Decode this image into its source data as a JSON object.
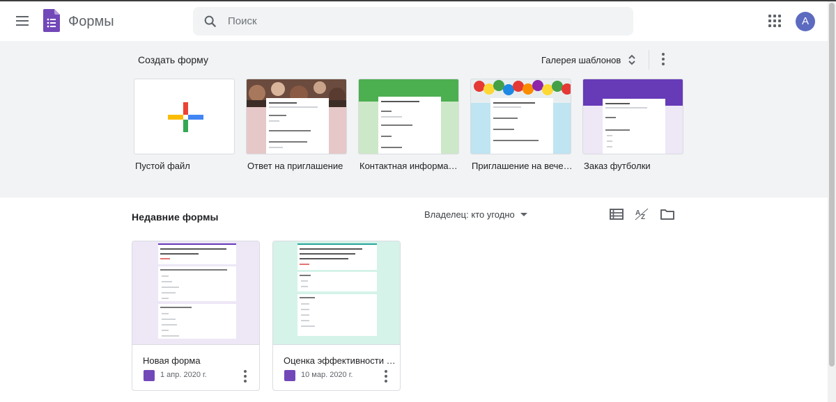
{
  "header": {
    "app_title": "Формы",
    "search_placeholder": "Поиск",
    "avatar_letter": "A",
    "menu_icon": "hamburger-menu-icon",
    "apps_icon": "apps-grid-icon"
  },
  "gallery": {
    "title": "Создать форму",
    "gallery_link": "Галерея шаблонов",
    "templates": [
      {
        "label": "Пустой файл"
      },
      {
        "label": "Ответ на приглашение"
      },
      {
        "label": "Контактная информа…"
      },
      {
        "label": "Приглашение на вече…"
      },
      {
        "label": "Заказ футболки"
      }
    ]
  },
  "recent": {
    "title": "Недавние формы",
    "owner_filter": "Владелец: кто угодно",
    "docs": [
      {
        "name": "Новая форма",
        "date": "1 апр. 2020 г."
      },
      {
        "name": "Оценка эффективности …",
        "date": "10 мар. 2020 г."
      }
    ]
  },
  "colors": {
    "forms_purple": "#7248b9",
    "gallery_bg": "#f1f3f4",
    "avatar": "#5c6bc0"
  }
}
